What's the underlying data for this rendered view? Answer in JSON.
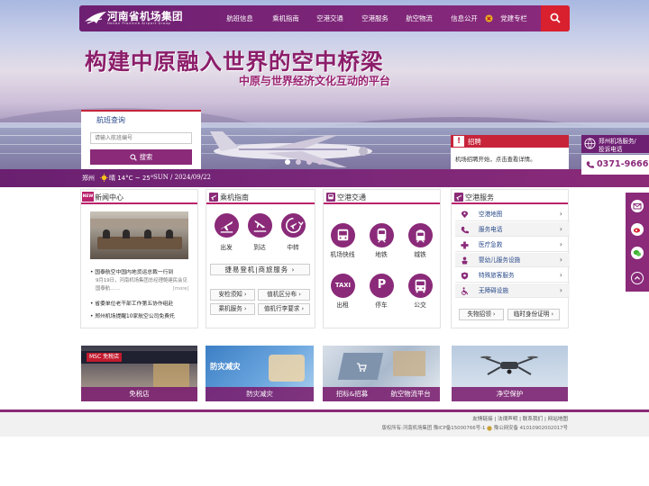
{
  "header": {
    "logo_cn": "河南省机场集团",
    "logo_en": "Henan Province Airport Group",
    "nav": [
      "航班信息",
      "乘机指南",
      "空港交通",
      "空港服务",
      "航空物流",
      "信息公开",
      "党建专栏"
    ]
  },
  "hero": {
    "title": "构建中原融入世界的空中桥梁",
    "subtitle": "中原与世界经济文化互动的平台"
  },
  "flight_search": {
    "title": "航班查询",
    "placeholder": "请输入航班编号",
    "button": "搜索"
  },
  "weather": {
    "city": "郑州",
    "text": "晴 14°C ~ 25°",
    "date": "SUN / 2024/09/22"
  },
  "recruit": {
    "title": "招聘",
    "text": "机场招聘开始，点击查看详情。"
  },
  "hotline": {
    "label1": "郑州机场服务/",
    "label2": "投诉电话",
    "phone": "0371-96666"
  },
  "news": {
    "badge": "NEW",
    "title": "新闻中心",
    "items": [
      {
        "title": "国泰航空中国内地货运总裁一行到",
        "summary": "9月19日，河南机场集团总经理鲍建民会见国泰航……",
        "more": "[more]"
      },
      {
        "title": "省委单位老干部工作第五协作组赴"
      },
      {
        "title": "郑州机场提醒10家航空公司免费托"
      }
    ]
  },
  "guide": {
    "title": "乘机指南",
    "icons": [
      "出发",
      "到达",
      "中转"
    ],
    "wide_button": "捷易登机|商旅服务",
    "buttons": [
      "安检须知",
      "值机区分布",
      "乘机服务",
      "值机行李要求"
    ]
  },
  "transport": {
    "title": "空港交通",
    "icons": [
      "机场快线",
      "地铁",
      "城铁",
      "出租",
      "停车",
      "公交"
    ],
    "icon_badges": {
      "taxi": "TAXI",
      "parking": "P"
    }
  },
  "services": {
    "title": "空港服务",
    "items": [
      "空港地图",
      "服务电话",
      "医疗急救",
      "婴幼儿服务设施",
      "特殊旅客服务",
      "无障碍设施"
    ],
    "buttons": [
      "失物招领",
      "临时身份证明"
    ]
  },
  "tiles": [
    {
      "label": "免税店",
      "sign": "MSC  免税店"
    },
    {
      "label": "防灾减灾",
      "sign": "防灾减灾"
    },
    {
      "label": "招标&招募"
    },
    {
      "label": "航空物流平台"
    },
    {
      "label": "净空保护"
    }
  ],
  "footer": {
    "links": "友情链接 | 法律声明 | 联系我们 | 网站地图",
    "copyright": "版权所有:河南机场集团 豫ICP备15000766号-1",
    "police": "豫公网安备 41010902002017号"
  },
  "colors": {
    "brand": "#8a2a79",
    "accent": "#d8202f"
  }
}
